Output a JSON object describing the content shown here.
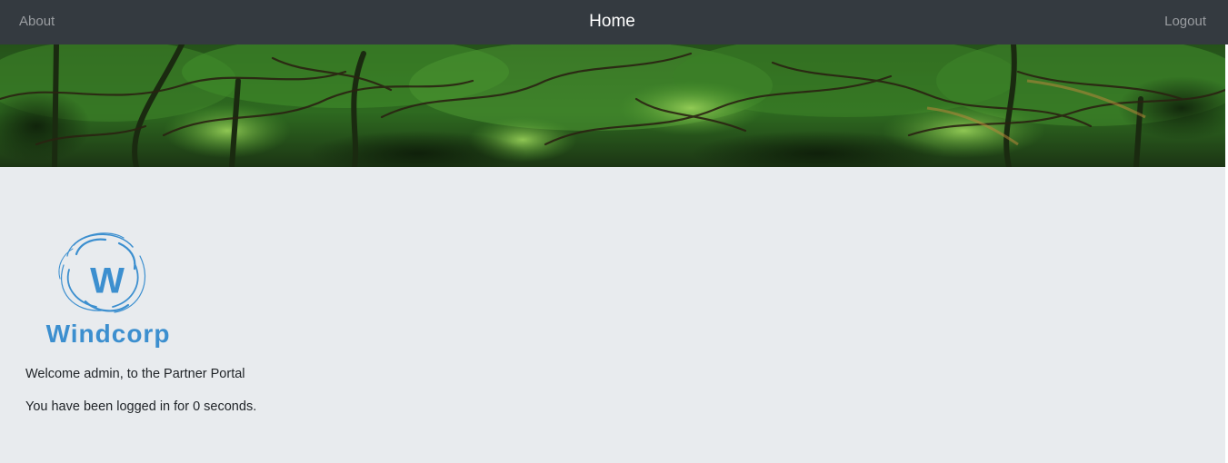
{
  "nav": {
    "about_label": "About",
    "brand_label": "Home",
    "logout_label": "Logout"
  },
  "logo": {
    "text": "Windcorp",
    "mark_letter": "W",
    "color": "#3c8fcf"
  },
  "main": {
    "welcome_text": "Welcome admin, to the Partner Portal",
    "timer_text": "You have been logged in for 0 seconds."
  },
  "colors": {
    "navbar_bg": "#343a40",
    "nav_link": "#9a9da1",
    "brand": "#ffffff",
    "panel_bg": "#e8ebee",
    "text": "#212529",
    "foliage": "#2f6b22"
  }
}
